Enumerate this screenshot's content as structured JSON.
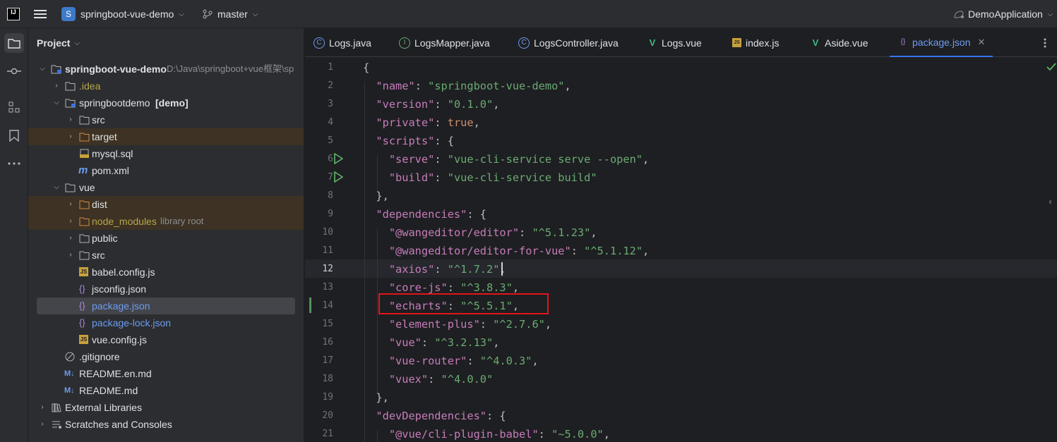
{
  "titlebar": {
    "logo_text": "IJ",
    "project_initial": "S",
    "project_name": "springboot-vue-demo",
    "branch": "master",
    "run_config": "DemoApplication"
  },
  "project_panel": {
    "title": "Project",
    "tree": [
      {
        "label": "springboot-vue-demo",
        "hint": "D:\\Java\\springboot+vue框架\\sp",
        "bold": true
      },
      {
        "label": ".idea"
      },
      {
        "label": "springbootdemo",
        "hint": "[demo]"
      },
      {
        "label": "src"
      },
      {
        "label": "target"
      },
      {
        "label": "mysql.sql"
      },
      {
        "label": "pom.xml"
      },
      {
        "label": "vue"
      },
      {
        "label": "dist"
      },
      {
        "label": "node_modules",
        "hint": "library root"
      },
      {
        "label": "public"
      },
      {
        "label": "src"
      },
      {
        "label": "babel.config.js"
      },
      {
        "label": "jsconfig.json"
      },
      {
        "label": "package.json"
      },
      {
        "label": "package-lock.json"
      },
      {
        "label": "vue.config.js"
      },
      {
        "label": ".gitignore"
      },
      {
        "label": "README.en.md"
      },
      {
        "label": "README.md"
      },
      {
        "label": "External Libraries"
      },
      {
        "label": "Scratches and Consoles"
      }
    ]
  },
  "tabs": [
    {
      "label": "Logs.java"
    },
    {
      "label": "LogsMapper.java"
    },
    {
      "label": "LogsController.java"
    },
    {
      "label": "Logs.vue"
    },
    {
      "label": "index.js"
    },
    {
      "label": "Aside.vue"
    },
    {
      "label": "package.json"
    }
  ],
  "editor": {
    "line_numbers": [
      "1",
      "2",
      "3",
      "4",
      "5",
      "6",
      "7",
      "8",
      "9",
      "10",
      "11",
      "12",
      "13",
      "14",
      "15",
      "16",
      "17",
      "18",
      "19",
      "20",
      "21"
    ],
    "lines": [
      [
        {
          "t": "p",
          "v": "{"
        }
      ],
      [
        {
          "t": "p",
          "v": "  "
        },
        {
          "t": "k",
          "v": "\"name\""
        },
        {
          "t": "p",
          "v": ": "
        },
        {
          "t": "s",
          "v": "\"springboot-vue-demo\""
        },
        {
          "t": "p",
          "v": ","
        }
      ],
      [
        {
          "t": "p",
          "v": "  "
        },
        {
          "t": "k",
          "v": "\"version\""
        },
        {
          "t": "p",
          "v": ": "
        },
        {
          "t": "s",
          "v": "\"0.1.0\""
        },
        {
          "t": "p",
          "v": ","
        }
      ],
      [
        {
          "t": "p",
          "v": "  "
        },
        {
          "t": "k",
          "v": "\"private\""
        },
        {
          "t": "p",
          "v": ": "
        },
        {
          "t": "b",
          "v": "true"
        },
        {
          "t": "p",
          "v": ","
        }
      ],
      [
        {
          "t": "p",
          "v": "  "
        },
        {
          "t": "k",
          "v": "\"scripts\""
        },
        {
          "t": "p",
          "v": ": {"
        }
      ],
      [
        {
          "t": "p",
          "v": "    "
        },
        {
          "t": "k",
          "v": "\"serve\""
        },
        {
          "t": "p",
          "v": ": "
        },
        {
          "t": "s",
          "v": "\"vue-cli-service serve --open\""
        },
        {
          "t": "p",
          "v": ","
        }
      ],
      [
        {
          "t": "p",
          "v": "    "
        },
        {
          "t": "k",
          "v": "\"build\""
        },
        {
          "t": "p",
          "v": ": "
        },
        {
          "t": "s",
          "v": "\"vue-cli-service build\""
        }
      ],
      [
        {
          "t": "p",
          "v": "  },"
        }
      ],
      [
        {
          "t": "p",
          "v": "  "
        },
        {
          "t": "k",
          "v": "\"dependencies\""
        },
        {
          "t": "p",
          "v": ": {"
        }
      ],
      [
        {
          "t": "p",
          "v": "    "
        },
        {
          "t": "k",
          "v": "\"@wangeditor/editor\""
        },
        {
          "t": "p",
          "v": ": "
        },
        {
          "t": "s",
          "v": "\"^5.1.23\""
        },
        {
          "t": "p",
          "v": ","
        }
      ],
      [
        {
          "t": "p",
          "v": "    "
        },
        {
          "t": "k",
          "v": "\"@wangeditor/editor-for-vue\""
        },
        {
          "t": "p",
          "v": ": "
        },
        {
          "t": "s",
          "v": "\"^5.1.12\""
        },
        {
          "t": "p",
          "v": ","
        }
      ],
      [
        {
          "t": "p",
          "v": "    "
        },
        {
          "t": "k",
          "v": "\"axios\""
        },
        {
          "t": "p",
          "v": ": "
        },
        {
          "t": "s",
          "v": "\"^1.7.2\""
        },
        {
          "t": "p",
          "v": ","
        }
      ],
      [
        {
          "t": "p",
          "v": "    "
        },
        {
          "t": "k",
          "v": "\"core-js\""
        },
        {
          "t": "p",
          "v": ": "
        },
        {
          "t": "s",
          "v": "\"^3.8.3\""
        },
        {
          "t": "p",
          "v": ","
        }
      ],
      [
        {
          "t": "p",
          "v": "    "
        },
        {
          "t": "k",
          "v": "\"echarts\""
        },
        {
          "t": "p",
          "v": ": "
        },
        {
          "t": "s",
          "v": "\"^5.5.1\""
        },
        {
          "t": "p",
          "v": ","
        }
      ],
      [
        {
          "t": "p",
          "v": "    "
        },
        {
          "t": "k",
          "v": "\"element-plus\""
        },
        {
          "t": "p",
          "v": ": "
        },
        {
          "t": "s",
          "v": "\"^2.7.6\""
        },
        {
          "t": "p",
          "v": ","
        }
      ],
      [
        {
          "t": "p",
          "v": "    "
        },
        {
          "t": "k",
          "v": "\"vue\""
        },
        {
          "t": "p",
          "v": ": "
        },
        {
          "t": "s",
          "v": "\"^3.2.13\""
        },
        {
          "t": "p",
          "v": ","
        }
      ],
      [
        {
          "t": "p",
          "v": "    "
        },
        {
          "t": "k",
          "v": "\"vue-router\""
        },
        {
          "t": "p",
          "v": ": "
        },
        {
          "t": "s",
          "v": "\"^4.0.3\""
        },
        {
          "t": "p",
          "v": ","
        }
      ],
      [
        {
          "t": "p",
          "v": "    "
        },
        {
          "t": "k",
          "v": "\"vuex\""
        },
        {
          "t": "p",
          "v": ": "
        },
        {
          "t": "s",
          "v": "\"^4.0.0\""
        }
      ],
      [
        {
          "t": "p",
          "v": "  },"
        }
      ],
      [
        {
          "t": "p",
          "v": "  "
        },
        {
          "t": "k",
          "v": "\"devDependencies\""
        },
        {
          "t": "p",
          "v": ": {"
        }
      ],
      [
        {
          "t": "p",
          "v": "    "
        },
        {
          "t": "k",
          "v": "\"@vue/cli-plugin-babel\""
        },
        {
          "t": "p",
          "v": ": "
        },
        {
          "t": "s",
          "v": "\"~5.0.0\""
        },
        {
          "t": "p",
          "v": ","
        }
      ]
    ]
  },
  "colors": {
    "accent": "#3574f0",
    "highlight_box": "#e0161b",
    "key": "#c77dbb",
    "string": "#6aab73",
    "keyword": "#cf8e6d"
  }
}
